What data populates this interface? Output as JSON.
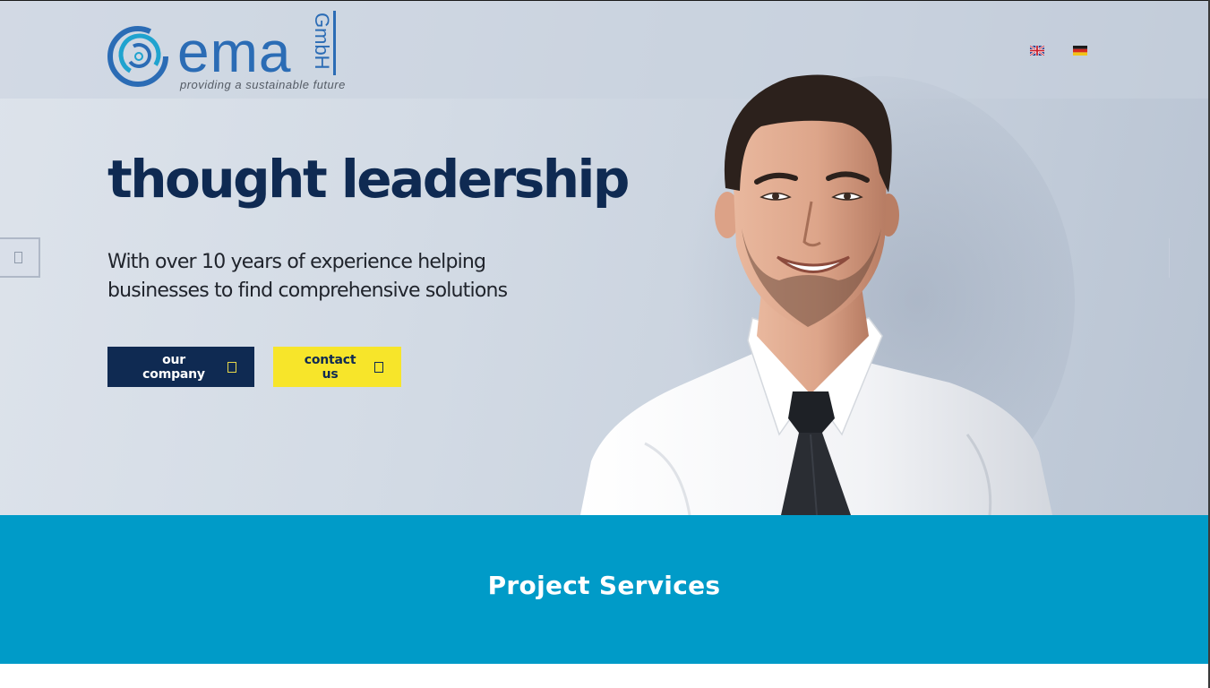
{
  "brand": {
    "name": "ema",
    "suffix": "GmbH",
    "tagline": "providing a sustainable future",
    "color": "#2b6cb5"
  },
  "languages": [
    {
      "code": "en",
      "icon": "uk-flag-icon"
    },
    {
      "code": "de",
      "icon": "germany-flag-icon"
    }
  ],
  "hero": {
    "title": "thought leadership",
    "subtitle": "With over 10 years of experience helping businesses to find comprehensive solutions",
    "buttons": {
      "company": "our company",
      "contact": "contact us"
    },
    "colors": {
      "title": "#0f2a52",
      "primary_button": "#0f2a52",
      "secondary_button": "#f7e52a"
    }
  },
  "services": {
    "title": "Project Services",
    "background": "#009bc8"
  }
}
